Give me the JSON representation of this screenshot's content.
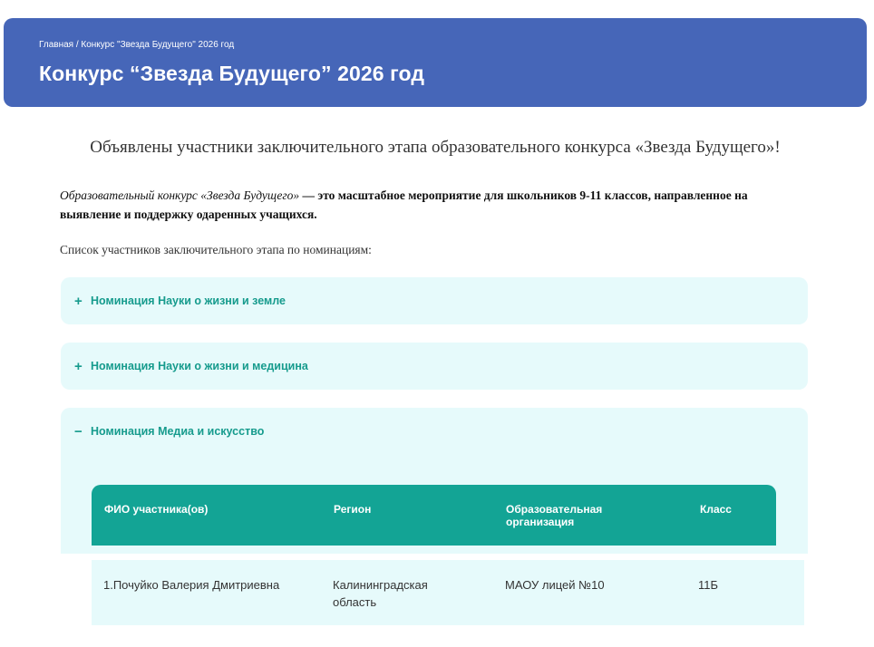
{
  "header": {
    "breadcrumb": "Главная / Конкурс \"Звезда Будущего\" 2026 год",
    "title": "Конкурс “Звезда Будущего” 2026 год"
  },
  "main": {
    "subtitle": "Объявлены участники заключительного этапа образовательного конкурса «Звезда Будущего»!",
    "intro_em": "Образовательный конкурс «Звезда Будущего»",
    "intro_rest": " — это масштабное мероприятие для школьников 9-11 классов,  направленное на выявление и поддержку одаренных учащихся.",
    "list_label": "Список участников заключительного этапа по номинациям:"
  },
  "accordion": [
    {
      "label": "Номинация Науки о жизни и земле",
      "icon": "plus-icon",
      "symbol": "+"
    },
    {
      "label": "Номинация Науки о жизни и медицина",
      "icon": "plus-icon",
      "symbol": "+"
    },
    {
      "label": "Номинация Медиа и искусство",
      "icon": "minus-icon",
      "symbol": "−"
    }
  ],
  "table": {
    "headers": [
      "ФИО участника(ов)",
      "Регион",
      "Образовательная организация",
      "Класс"
    ],
    "rows": [
      [
        "1.Почуйко Валерия Дмитриевна",
        "Калининградская область",
        "МАОУ лицей №10",
        "11Б"
      ]
    ]
  },
  "colors": {
    "header_bg": "#4666b8",
    "accent": "#169b8d",
    "table_head_bg": "#13a495",
    "panel_bg": "#e6fafb"
  }
}
